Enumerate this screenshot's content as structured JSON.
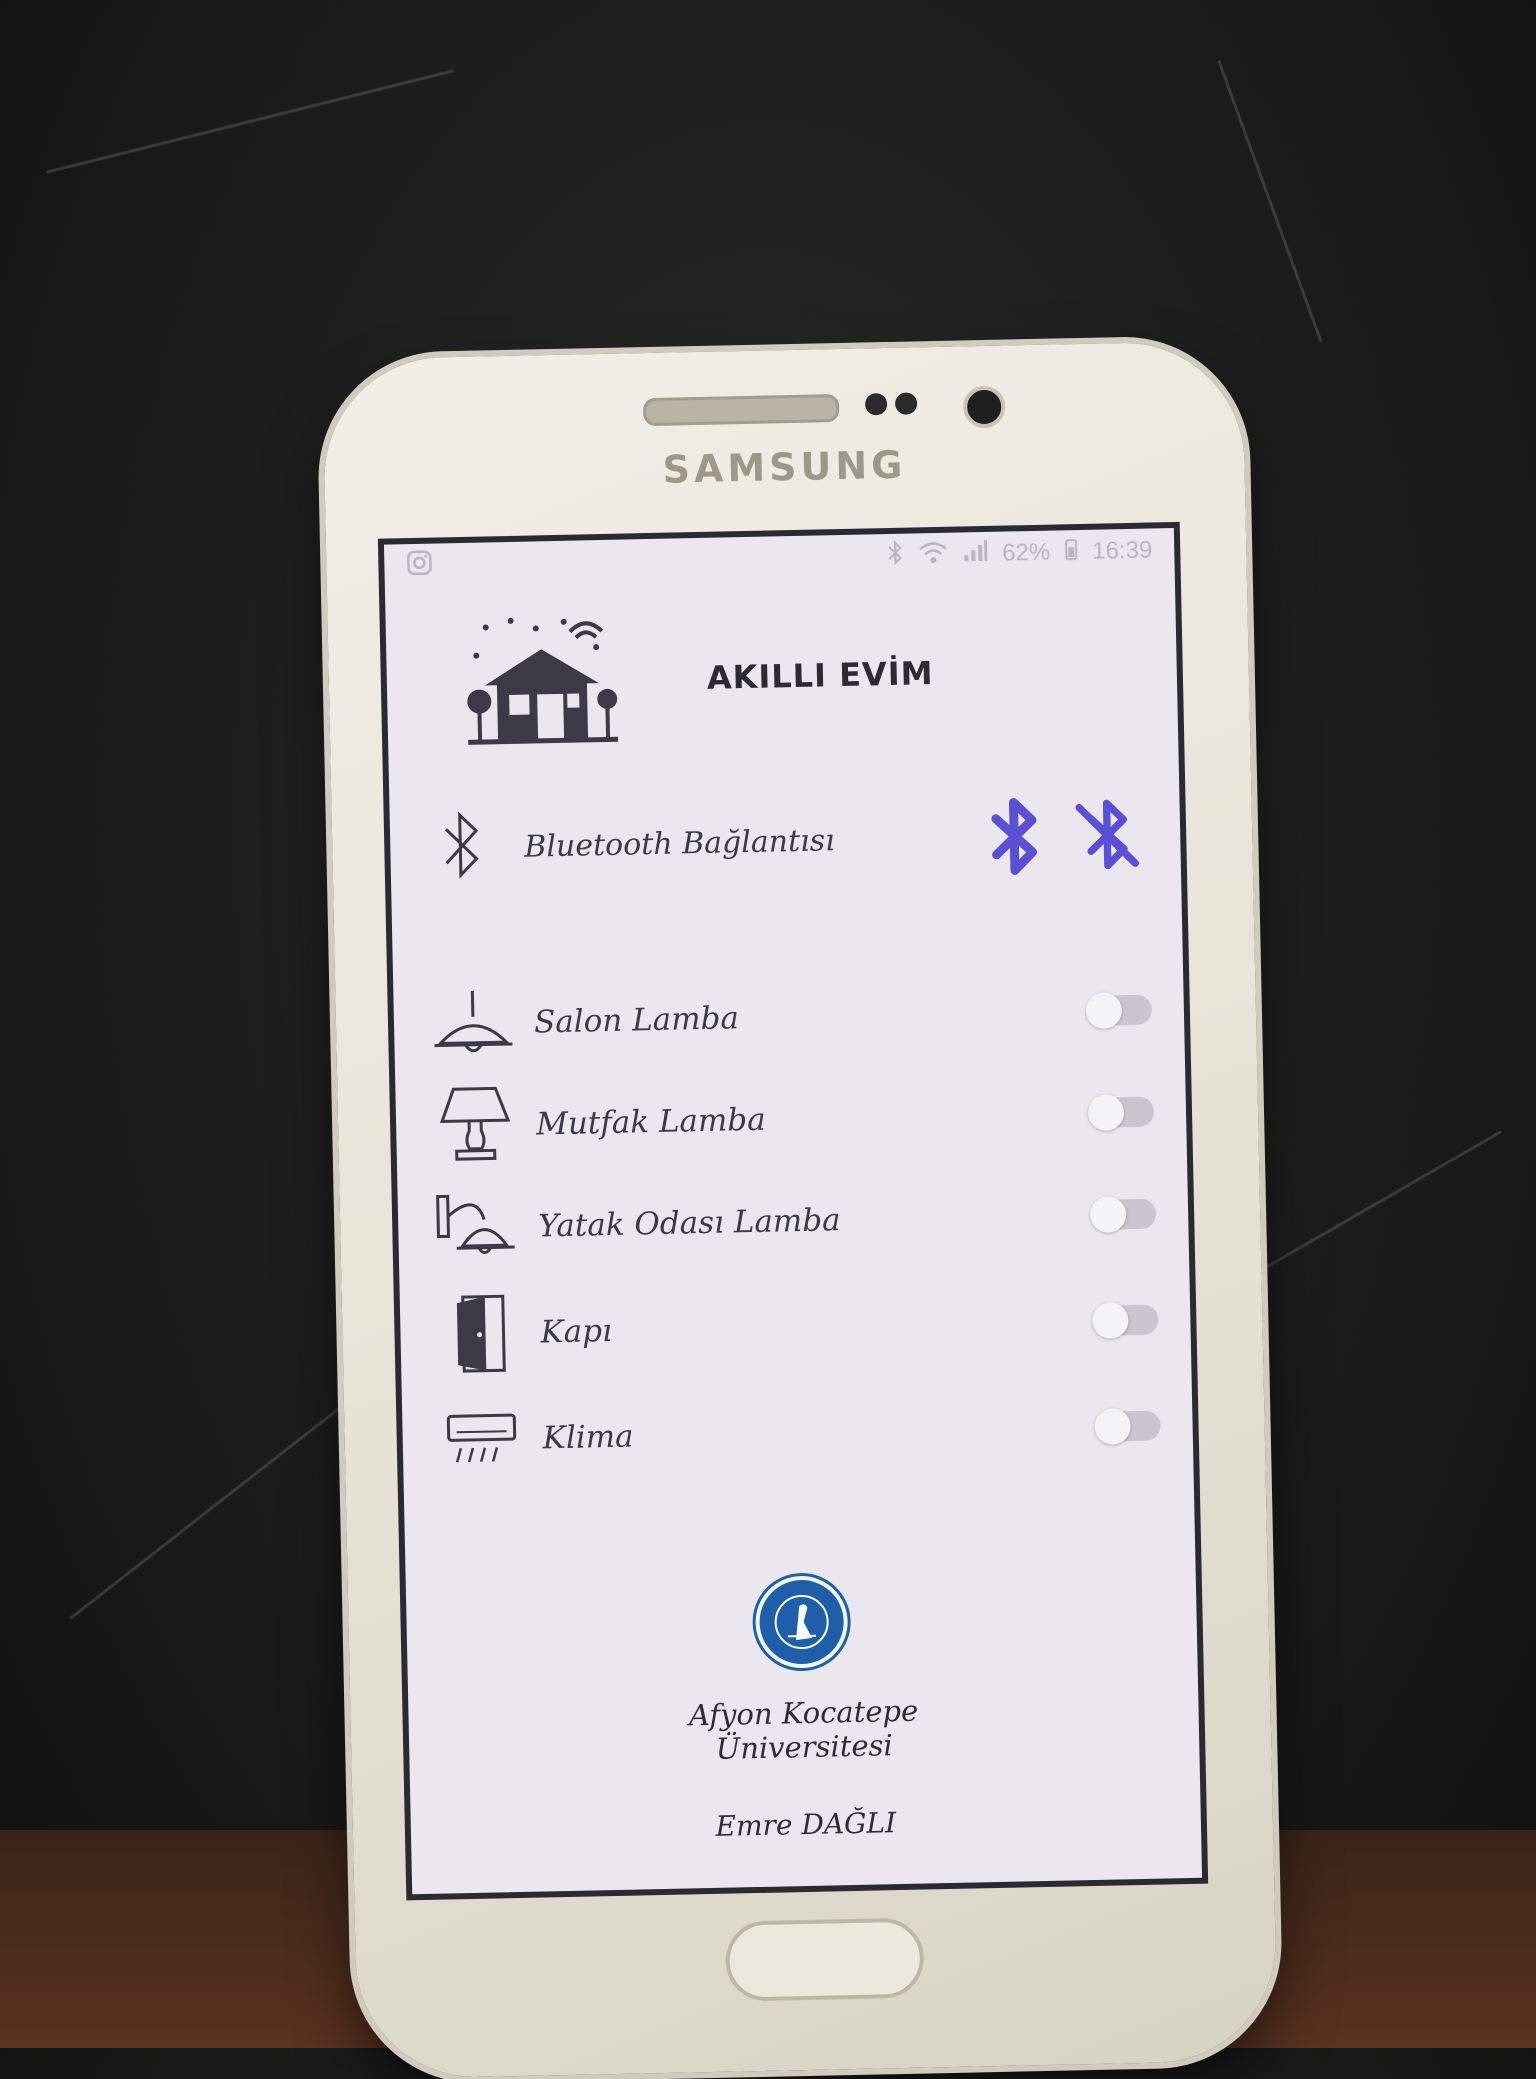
{
  "status_bar": {
    "battery": "62%",
    "time": "16:39"
  },
  "app": {
    "title": "AKILLI EVİM"
  },
  "bluetooth": {
    "label": "Bluetooth Bağlantısı",
    "accent_color": "#5b4fd6"
  },
  "devices": [
    {
      "label": "Salon Lamba",
      "icon": "ceiling-lamp-icon",
      "on": false
    },
    {
      "label": "Mutfak Lamba",
      "icon": "table-lamp-icon",
      "on": false
    },
    {
      "label": "Yatak Odası Lamba",
      "icon": "wall-lamp-icon",
      "on": false
    },
    {
      "label": "Kapı",
      "icon": "door-icon",
      "on": false
    },
    {
      "label": "Klima",
      "icon": "air-conditioner-icon",
      "on": false
    }
  ],
  "footer": {
    "university_line1": "Afyon Kocatepe",
    "university_line2": "Üniversitesi",
    "author": "Emre DAĞLI"
  },
  "device_brand": "SAMSUNG"
}
